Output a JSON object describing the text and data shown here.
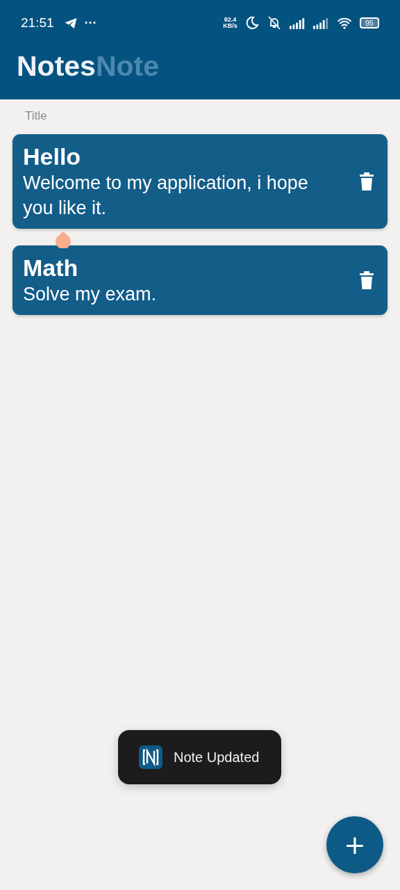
{
  "status_bar": {
    "time": "21:51",
    "more": "···",
    "speed_value": "92.4",
    "speed_unit": "KB/s",
    "battery": "95"
  },
  "app_bar": {
    "title": "Notes",
    "fading_title": "Note"
  },
  "fading_field": {
    "label": "Title"
  },
  "notes": [
    {
      "title": "Hello",
      "body": "Welcome to my application, i hope you like it.",
      "text_handle": true
    },
    {
      "title": "Math",
      "body": "Solve my exam.",
      "text_handle": false
    }
  ],
  "toast": {
    "text": "Note Updated"
  },
  "fab": {
    "label": "+"
  }
}
